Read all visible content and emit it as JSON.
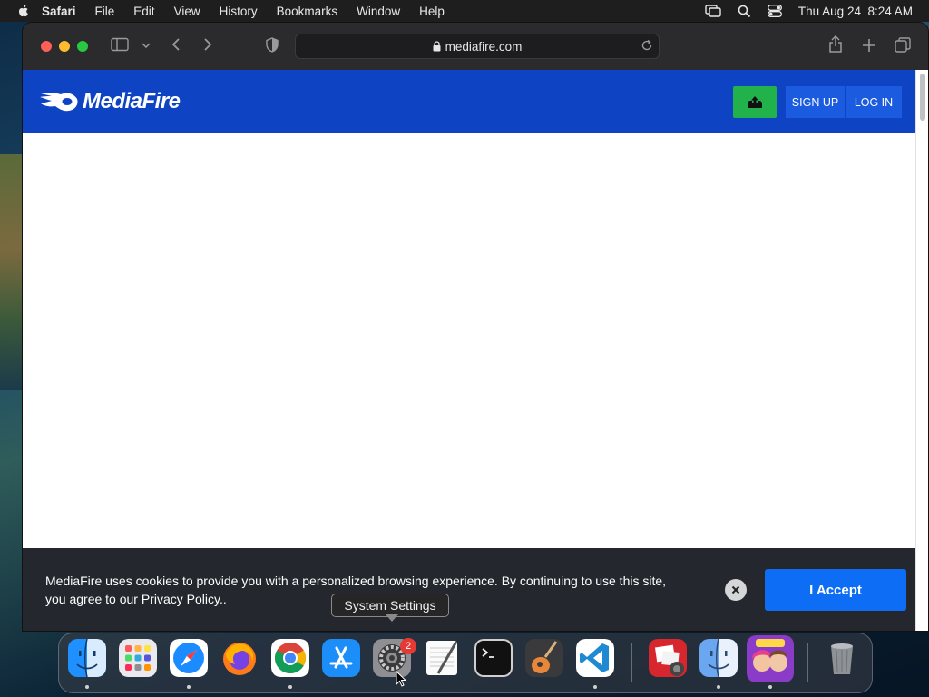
{
  "menubar": {
    "app_name": "Safari",
    "items": [
      "File",
      "Edit",
      "View",
      "History",
      "Bookmarks",
      "Window",
      "Help"
    ],
    "clock": "Thu Aug 24  8:24 AM"
  },
  "browser": {
    "address": "mediafire.com"
  },
  "site": {
    "logo_text": "MediaFire",
    "signup_label": "SIGN UP",
    "login_label": "LOG IN",
    "brand_color": "#0e44c4"
  },
  "cookie": {
    "message": "MediaFire uses cookies to provide you with a personalized browsing experience. By continuing to use this site, you agree to our Privacy Policy..",
    "accept_label": "I Accept"
  },
  "dock": {
    "apps": [
      "Finder",
      "Launchpad",
      "Safari",
      "Firefox",
      "Google Chrome",
      "App Store",
      "System Settings",
      "TextEdit",
      "Terminal",
      "GarageBand",
      "Visual Studio Code",
      "Photo Booth",
      "Finder",
      "Game",
      "Trash"
    ],
    "system_settings_badge": "2",
    "tooltip": "System Settings"
  }
}
